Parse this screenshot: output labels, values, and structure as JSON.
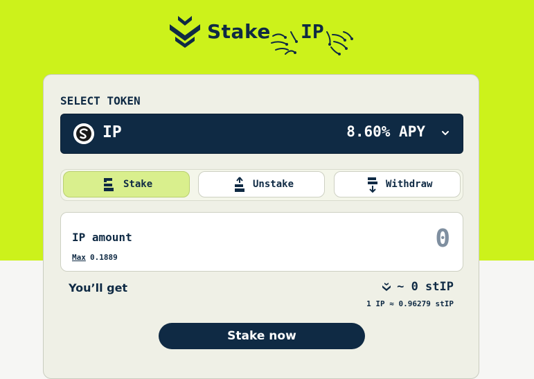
{
  "colors": {
    "accent": "#ccf21b",
    "navy": "#0f2a44",
    "card": "#eff0e6",
    "tab_active": "#d9ef8d"
  },
  "header": {
    "brand": "Stake",
    "token_title": "IP",
    "brand_icon": "chevron-stack-logo-icon",
    "decor_icon": "sparkle-icon"
  },
  "select_token": {
    "label": "SELECT TOKEN",
    "token": "IP",
    "apy": "8.60% APY",
    "token_icon": "story-token-icon",
    "chevron_icon": "chevron-down-icon"
  },
  "tabs": [
    {
      "label": "Stake",
      "icon": "stake-icon",
      "active": true
    },
    {
      "label": "Unstake",
      "icon": "unstake-icon",
      "active": false
    },
    {
      "label": "Withdraw",
      "icon": "withdraw-icon",
      "active": false
    }
  ],
  "amount": {
    "label": "IP amount",
    "placeholder": "0",
    "max_label": "Max",
    "balance": "0.1889"
  },
  "receive": {
    "label": "You’ll get",
    "value": "~ 0 stIP",
    "rate": "1 IP ≈ 0.96279 stIP"
  },
  "cta": {
    "label": "Stake now"
  }
}
